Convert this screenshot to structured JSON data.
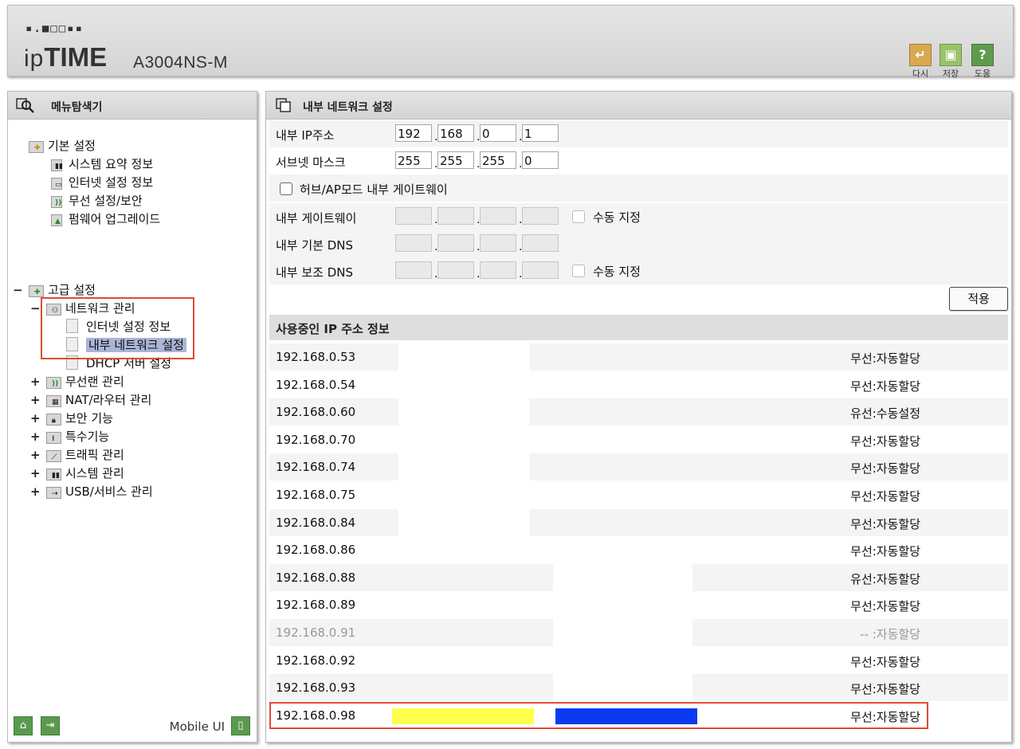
{
  "header": {
    "brand_dots": "■■▪▪▪▪■",
    "logo_prefix": "ip",
    "logo_main": "TIME",
    "model": "A3004NS-M",
    "buttons": [
      {
        "label": "다시",
        "icon": "undo-icon",
        "color": "#d9a94f"
      },
      {
        "label": "저장",
        "icon": "save-icon",
        "color": "#9bc26b"
      },
      {
        "label": "도움",
        "icon": "help-icon",
        "color": "#5f9b4c"
      }
    ]
  },
  "menu": {
    "title": "메뉴탐색기",
    "basic": {
      "label": "기본 설정",
      "items": [
        "시스템 요약 정보",
        "인터넷 설정 정보",
        "무선 설정/보안",
        "펌웨어 업그레이드"
      ]
    },
    "advanced": {
      "label": "고급 설정",
      "expander": "−",
      "network": {
        "label": "네트워크 관리",
        "expander": "−",
        "items": [
          "인터넷 설정 정보",
          "내부 네트워크 설정",
          "DHCP 서버 설정"
        ]
      },
      "groups": [
        {
          "label": "무선랜 관리",
          "expander": "+"
        },
        {
          "label": "NAT/라우터 관리",
          "expander": "+"
        },
        {
          "label": "보안 기능",
          "expander": "+"
        },
        {
          "label": "특수기능",
          "expander": "+"
        },
        {
          "label": "트래픽 관리",
          "expander": "+"
        },
        {
          "label": "시스템 관리",
          "expander": "+"
        },
        {
          "label": "USB/서비스 관리",
          "expander": "+"
        }
      ]
    },
    "mobile_label": "Mobile UI"
  },
  "panel": {
    "title": "내부 네트워크 설정",
    "ip_label": "내부 IP주소",
    "ip": [
      "192",
      "168",
      "0",
      "1"
    ],
    "mask_label": "서브넷 마스크",
    "mask": [
      "255",
      "255",
      "255",
      "0"
    ],
    "hub_label": "허브/AP모드 내부 게이트웨이",
    "gateway_label": "내부 게이트웨이",
    "dns1_label": "내부 기본 DNS",
    "dns2_label": "내부 보조 DNS",
    "manual_label": "수동 지정",
    "apply_label": "적용",
    "list_title": "사용중인 IP 주소 정보",
    "rows": [
      {
        "ip": "192.168.0.53",
        "status": "무선:자동할당"
      },
      {
        "ip": "192.168.0.54",
        "status": "무선:자동할당"
      },
      {
        "ip": "192.168.0.60",
        "status": "유선:수동설정"
      },
      {
        "ip": "192.168.0.70",
        "status": "무선:자동할당"
      },
      {
        "ip": "192.168.0.74",
        "status": "무선:자동할당"
      },
      {
        "ip": "192.168.0.75",
        "status": "무선:자동할당"
      },
      {
        "ip": "192.168.0.84",
        "status": "무선:자동할당"
      },
      {
        "ip": "192.168.0.86",
        "status": "무선:자동할당"
      },
      {
        "ip": "192.168.0.88",
        "status": "유선:자동할당"
      },
      {
        "ip": "192.168.0.89",
        "status": "무선:자동할당"
      },
      {
        "ip": "192.168.0.91",
        "status": "-- :자동할당"
      },
      {
        "ip": "192.168.0.92",
        "status": "무선:자동할당"
      },
      {
        "ip": "192.168.0.93",
        "status": "무선:자동할당"
      },
      {
        "ip": "192.168.0.98",
        "status": "무선:자동할당"
      }
    ]
  },
  "colors": {
    "highlight_box": "#e04a36",
    "selection": "#a9b4d6",
    "redact_yellow": "#ffff4d",
    "redact_blue": "#0a3bf0"
  }
}
